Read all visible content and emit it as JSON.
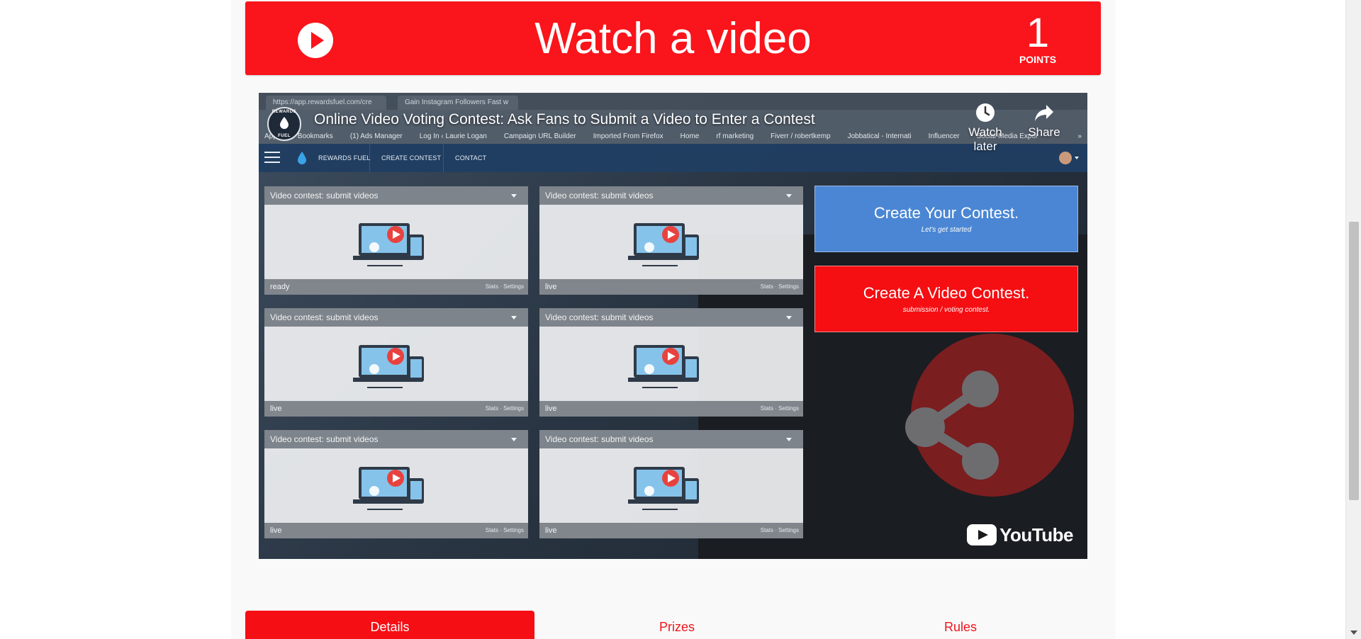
{
  "header": {
    "title": "Watch a video",
    "points_value": "1",
    "points_label": "POINTS",
    "color": "#fa141b"
  },
  "video": {
    "title": "Online Video Voting Contest: Ask Fans to Submit a Video to Enter a Contest",
    "channel_logo_text_top": "REWARDS",
    "channel_logo_text_bottom": "FUEL",
    "watch_later": "Watch later",
    "share": "Share",
    "youtube_logo": "YouTube",
    "browser": {
      "tabs": [
        "https://app.rewardsfuel.com/cre",
        "Gain Instagram Followers Fast w"
      ],
      "bookmarks": [
        "Apps",
        "Bookmarks",
        "(1) Ads Manager",
        "Log In ‹ Laurie Logan",
        "Campaign URL Builder",
        "Imported From Firefox",
        "Home",
        "rf marketing",
        "Fiverr / robertkemp",
        "Jobbatical - Internati",
        "Influencer",
        "Social-Media Expor",
        "»"
      ]
    },
    "app_nav": {
      "brand": "REWARDS FUEL",
      "items": [
        "CREATE CONTEST",
        "CONTACT"
      ]
    },
    "cards": [
      {
        "title": "Video contest: submit videos",
        "status": "ready",
        "stats": "Stats",
        "settings": "Settings"
      },
      {
        "title": "Video contest: submit videos",
        "status": "live",
        "stats": "Stats",
        "settings": "Settings"
      },
      {
        "title": "Video contest: submit videos",
        "status": "live",
        "stats": "Stats",
        "settings": "Settings"
      },
      {
        "title": "Video contest: submit videos",
        "status": "live",
        "stats": "Stats",
        "settings": "Settings"
      },
      {
        "title": "Video contest: submit videos",
        "status": "live",
        "stats": "Stats",
        "settings": "Settings"
      },
      {
        "title": "Video contest: submit videos",
        "status": "live",
        "stats": "Stats",
        "settings": "Settings"
      }
    ],
    "cta_primary": {
      "title": "Create Your Contest.",
      "subtitle": "Let's get started",
      "color": "#4a86d4"
    },
    "cta_video": {
      "title": "Create A Video Contest.",
      "subtitle": "submission / voting contest.",
      "color": "#f50e12"
    }
  },
  "tabs": {
    "details": "Details",
    "prizes": "Prizes",
    "rules": "Rules",
    "active": "details"
  },
  "icons": {
    "header_play": "play-circle-icon",
    "watch_later": "clock-icon",
    "share": "share-arrow-icon"
  }
}
